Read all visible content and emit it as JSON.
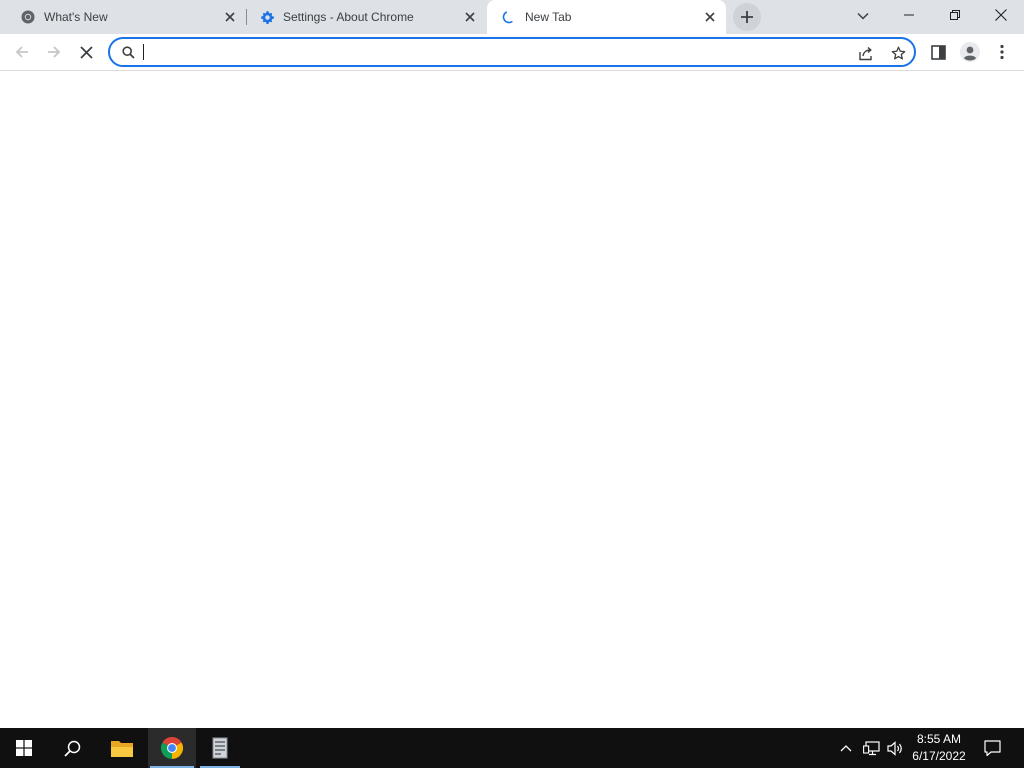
{
  "browser": {
    "tabs": [
      {
        "title": "What's New",
        "favicon": "chrome-logo-icon",
        "active": false
      },
      {
        "title": "Settings - About Chrome",
        "favicon": "settings-gear-icon",
        "active": false
      },
      {
        "title": "New Tab",
        "favicon": "loading-spinner-icon",
        "active": true
      }
    ],
    "new_tab_icon": "plus-icon",
    "tab_search_icon": "chevron-down-icon",
    "window_controls": [
      "minimize-icon",
      "restore-icon",
      "close-icon"
    ]
  },
  "toolbar": {
    "back_icon": "arrow-left-icon",
    "forward_icon": "arrow-right-icon",
    "stop_icon": "stop-x-icon",
    "omnibox": {
      "value": "",
      "placeholder": "",
      "leading_icon": "search-icon"
    },
    "share_icon": "share-icon",
    "bookmark_icon": "star-outline-icon",
    "side_panel_icon": "side-panel-icon",
    "profile_icon": "person-avatar-icon",
    "menu_icon": "kebab-menu-icon"
  },
  "taskbar": {
    "apps": [
      {
        "name": "Start",
        "icon": "windows-logo-icon"
      },
      {
        "name": "Search",
        "icon": "search-icon"
      },
      {
        "name": "File Explorer",
        "icon": "folder-icon"
      },
      {
        "name": "Google Chrome",
        "icon": "chrome-logo-icon",
        "active": true
      },
      {
        "name": "App",
        "icon": "document-app-icon",
        "running": true
      }
    ],
    "tray_icons": [
      "chevron-up-icon",
      "network-icon",
      "volume-icon"
    ],
    "clock": {
      "time": "8:55 AM",
      "date": "6/17/2022"
    },
    "notification_icon": "notification-icon"
  },
  "colors": {
    "tabstrip_bg": "#dee1e6",
    "accent": "#1a73e8",
    "taskbar_bg": "#101010",
    "taskbar_active_underline": "#7fb2e5"
  }
}
